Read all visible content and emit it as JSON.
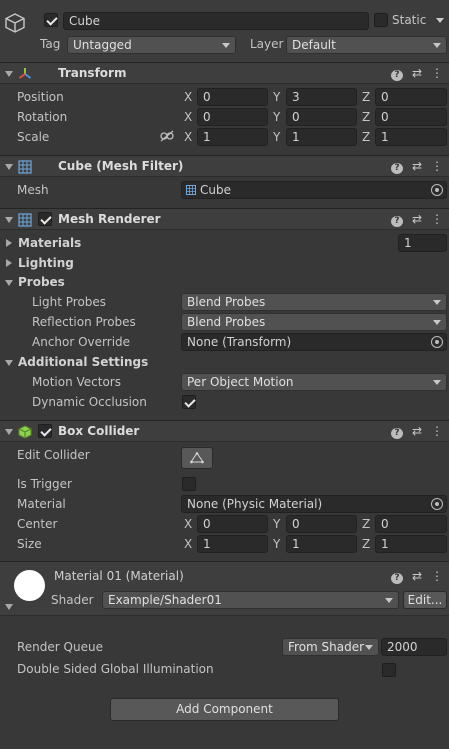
{
  "object": {
    "name": "Cube",
    "static_label": "Static",
    "tag_label": "Tag",
    "tag_value": "Untagged",
    "layer_label": "Layer",
    "layer_value": "Default"
  },
  "transform": {
    "title": "Transform",
    "rows": [
      {
        "label": "Position",
        "x": "0",
        "y": "3",
        "z": "0"
      },
      {
        "label": "Rotation",
        "x": "0",
        "y": "0",
        "z": "0"
      },
      {
        "label": "Scale",
        "x": "1",
        "y": "1",
        "z": "1"
      }
    ]
  },
  "axes": {
    "x": "X",
    "y": "Y",
    "z": "Z"
  },
  "mesh_filter": {
    "title": "Cube (Mesh Filter)",
    "mesh_label": "Mesh",
    "mesh_value": "Cube"
  },
  "mesh_renderer": {
    "title": "Mesh Renderer",
    "materials_label": "Materials",
    "materials_count": "1",
    "lighting_label": "Lighting",
    "probes_label": "Probes",
    "light_probes_label": "Light Probes",
    "light_probes_value": "Blend Probes",
    "reflection_probes_label": "Reflection Probes",
    "reflection_probes_value": "Blend Probes",
    "anchor_override_label": "Anchor Override",
    "anchor_override_value": "None (Transform)",
    "additional_label": "Additional Settings",
    "motion_vectors_label": "Motion Vectors",
    "motion_vectors_value": "Per Object Motion",
    "dynamic_occlusion_label": "Dynamic Occlusion"
  },
  "box_collider": {
    "title": "Box Collider",
    "edit_collider_label": "Edit Collider",
    "is_trigger_label": "Is Trigger",
    "material_label": "Material",
    "material_value": "None (Physic Material)",
    "center": {
      "label": "Center",
      "x": "0",
      "y": "0",
      "z": "0"
    },
    "size": {
      "label": "Size",
      "x": "1",
      "y": "1",
      "z": "1"
    }
  },
  "material": {
    "title": "Material 01 (Material)",
    "shader_label": "Shader",
    "shader_value": "Example/Shader01",
    "edit_label": "Edit...",
    "render_queue_label": "Render Queue",
    "render_queue_mode": "From Shader",
    "render_queue_value": "2000",
    "dsgi_label": "Double Sided Global Illumination"
  },
  "add_component_label": "Add Component",
  "colors": {
    "background": "#383838",
    "field": "#2a2a2a",
    "header": "#3e3e3e",
    "transform_axis_x": "#e0523e",
    "transform_axis_y": "#8dc63f",
    "transform_axis_z": "#4a8fe0",
    "collider_icon": "#8fd14f"
  }
}
